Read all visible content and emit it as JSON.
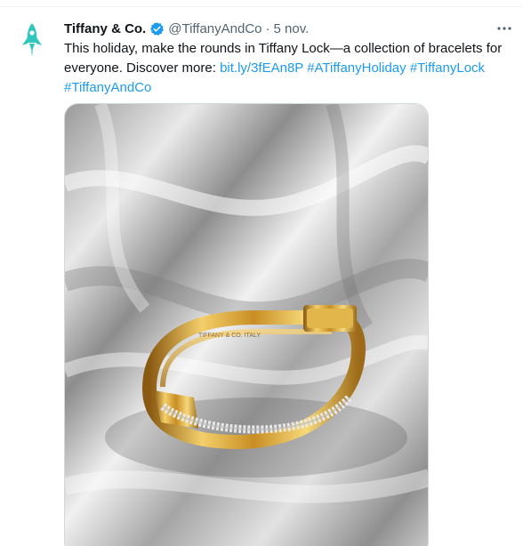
{
  "tweet": {
    "author_name": "Tiffany & Co.",
    "handle": "@TiffanyAndCo",
    "separator": "·",
    "date": "5 nov.",
    "more_icon": "more-horizontal-icon",
    "avatar_icon": "rocket-icon",
    "verified_icon": "verified-badge-icon",
    "text_line1": "This holiday, make the rounds in Tiffany Lock—a collection of bracelets for",
    "text_line2_plain": "everyone. Discover more: ",
    "link_url": "bit.ly/3fEAn8P",
    "hashtag1": "#ATiffanyHoliday",
    "hashtag2": "#TiffanyLock",
    "hashtag3": "#TiffanyAndCo",
    "media_alt": "gold-bracelet-photo",
    "bracelet_engraving": "TIFFANY & CO. ITALY"
  },
  "colors": {
    "text": "#0f1419",
    "secondary": "#536471",
    "link": "#1d9bf0",
    "verified": "#1d9bf0",
    "avatar": "#2fc7bd",
    "gold": "#d9a52b"
  }
}
